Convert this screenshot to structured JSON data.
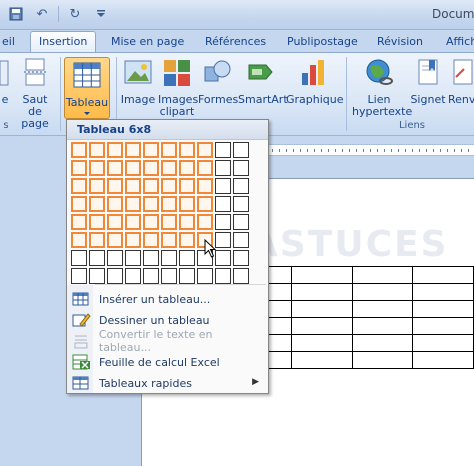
{
  "window": {
    "title": "Docum"
  },
  "qat": {
    "undo": "↶",
    "redo": "↻"
  },
  "tabs": [
    {
      "label": "eil"
    },
    {
      "label": "Insertion"
    },
    {
      "label": "Mise en page"
    },
    {
      "label": "Références"
    },
    {
      "label": "Publipostage"
    },
    {
      "label": "Révision"
    },
    {
      "label": "Affich"
    }
  ],
  "ribbon": {
    "buttons": {
      "partial_left": "e",
      "saut_de_page": "Saut de page",
      "tableau": "Tableau",
      "image": "Image",
      "images_clipart": "Images clipart",
      "formes": "Formes",
      "smartart": "SmartArt",
      "graphique": "Graphique",
      "lien_hypertexte": "Lien hypertexte",
      "signet": "Signet",
      "renvoi": "Renv"
    },
    "groups": {
      "left": "s",
      "liens": "Liens"
    }
  },
  "table_menu": {
    "header": "Tableau 6x8",
    "grid": {
      "columns": 10,
      "rows": 8,
      "selected_columns": 8,
      "selected_rows": 6
    },
    "items": [
      {
        "label": "Insérer un tableau...",
        "enabled": true
      },
      {
        "label": "Dessiner un tableau",
        "enabled": true
      },
      {
        "label": "Convertir le texte en tableau...",
        "enabled": false
      },
      {
        "label": "Feuille de calcul Excel",
        "enabled": true
      },
      {
        "label": "Tableaux rapides",
        "enabled": true
      }
    ]
  },
  "watermark": "ASTUCES",
  "colors": {
    "accent": "#f0883a",
    "ribbon_text": "#15428b",
    "selected_button": "#ffc35a"
  }
}
